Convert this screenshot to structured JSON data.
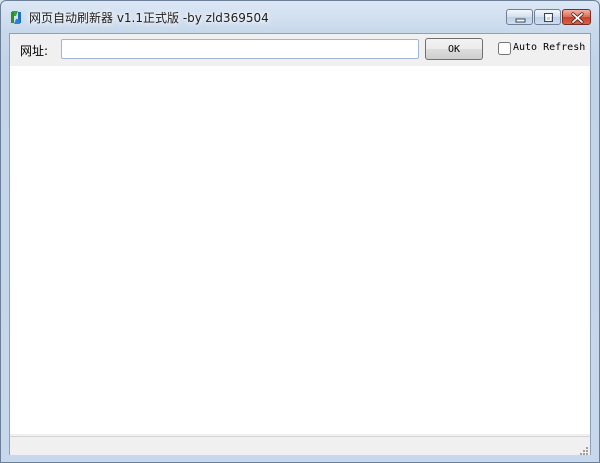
{
  "window": {
    "title": "网页自动刷新器 v1.1正式版 -by zld369504",
    "app_icon": "refresh-app-icon",
    "controls": {
      "minimize_icon": "minimize-icon",
      "maximize_icon": "maximize-icon",
      "close_icon": "close-icon"
    }
  },
  "toolbar": {
    "url_label": "网址:",
    "url_value": "",
    "url_placeholder": "",
    "ok_label": "OK",
    "auto_refresh_label": "Auto Refresh",
    "auto_refresh_checked": false
  },
  "statusbar": {
    "text": ""
  },
  "colors": {
    "title_bar": "#c9d9ec",
    "client_bg": "#f0f0f0",
    "browser_bg": "#ffffff",
    "close_button": "#c7432c"
  }
}
